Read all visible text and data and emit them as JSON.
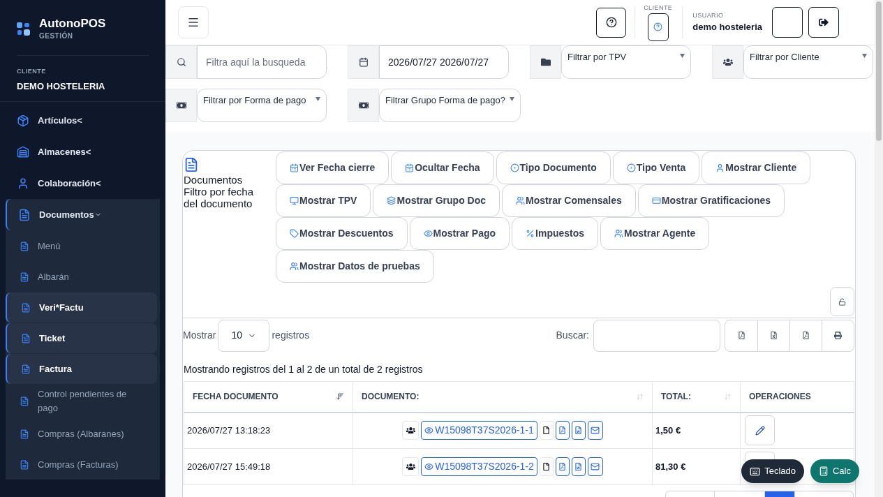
{
  "sidebar": {
    "brand": {
      "name": "AutonoPOS",
      "subtitle": "GESTIÓN"
    },
    "client": {
      "label": "CLIENTE",
      "name": "DEMO HOSTELERIA"
    },
    "items": [
      {
        "label": "Artículos<",
        "expanded": false
      },
      {
        "label": "Almacenes<",
        "expanded": false
      },
      {
        "label": "Colaboración<",
        "expanded": false
      },
      {
        "label": "Documentos",
        "expanded": true,
        "children": [
          {
            "label": "Menú",
            "selected": false
          },
          {
            "label": "Albarán",
            "selected": false
          },
          {
            "label": "Veri*Factu",
            "selected": true
          },
          {
            "label": "Ticket",
            "selected": true
          },
          {
            "label": "Factura",
            "selected": true
          },
          {
            "label": "Control pendientes de pago",
            "selected": false
          },
          {
            "label": "Compras (Albaranes)",
            "selected": false
          },
          {
            "label": "Compras (Facturas)",
            "selected": false
          }
        ]
      }
    ]
  },
  "header": {
    "client_label": "CLIENTE",
    "user_label": "USUARIO",
    "user_name": "demo hosteleria"
  },
  "filters": [
    [
      {
        "kind": "text",
        "placeholder": "Filtra aquí la busqueda"
      },
      {
        "kind": "date",
        "value": "2026/07/27 2026/07/27"
      },
      {
        "kind": "select",
        "value": "Filtrar por TPV"
      },
      {
        "kind": "select",
        "value": "Filtrar por Cliente"
      }
    ],
    [
      {
        "kind": "select",
        "value": "Filtrar por Forma de pago"
      },
      {
        "kind": "select",
        "value": "Filtrar Grupo Forma de pago?"
      }
    ]
  ],
  "card": {
    "title": "Documentos",
    "subtitle": "Filtro por fecha del documento",
    "toggles": [
      [
        {
          "label": "Ver Fecha cierre"
        },
        {
          "label": "Ocultar Fecha"
        },
        {
          "label": "Tipo Documento"
        },
        {
          "label": "Tipo Venta"
        },
        {
          "label": "Mostrar Cliente"
        }
      ],
      [
        {
          "label": "Mostrar TPV"
        },
        {
          "label": "Mostrar Grupo Doc"
        },
        {
          "label": "Mostrar Comensales"
        },
        {
          "label": "Mostrar Gratificaciones"
        }
      ],
      [
        {
          "label": "Mostrar Descuentos"
        },
        {
          "label": "Mostrar Pago"
        },
        {
          "label": "Impuestos"
        },
        {
          "label": "Mostrar Agente"
        }
      ],
      [
        {
          "label": "Mostrar Datos de pruebas"
        }
      ]
    ]
  },
  "table_controls": {
    "show_label": "Mostrar",
    "page_size": "10",
    "records_label": "registros",
    "search_label": "Buscar:"
  },
  "info": "Mostrando registros del 1 al 2 de un total de 2 registros",
  "table": {
    "columns": [
      {
        "label": "FECHA DOCUMENTO",
        "sortable": true,
        "sorted": true
      },
      {
        "label": "DOCUMENTO:",
        "sortable": true,
        "sorted": false
      },
      {
        "label": "TOTAL:",
        "sortable": true,
        "sorted": false
      },
      {
        "label": "OPERACIONES",
        "sortable": false
      }
    ],
    "rows": [
      {
        "date": "2026/07/27 13:18:23",
        "document": "W15098T37S2026-1-1",
        "total": "1,50 €"
      },
      {
        "date": "2026/07/27 15:49:18",
        "document": "W15098T37S2026-1-2",
        "total": "81,30 €"
      }
    ]
  },
  "floating": {
    "keyboard": "Teclado",
    "calc": "Calc"
  }
}
